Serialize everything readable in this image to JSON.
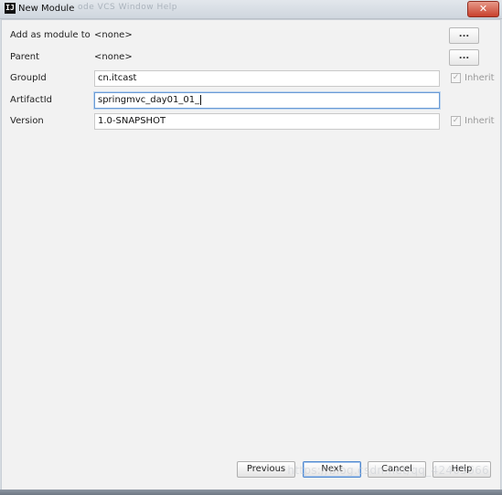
{
  "window": {
    "title": "New Module",
    "app_icon_text": "IJ",
    "ghost_menu": "ode  VCS  Window  Help"
  },
  "form": {
    "add_as_module_to": {
      "label": "Add as module to",
      "value": "<none>",
      "button": "..."
    },
    "parent": {
      "label": "Parent",
      "value": "<none>",
      "button": "..."
    },
    "group_id": {
      "label": "GroupId",
      "value": "cn.itcast",
      "inherit_label": "Inherit",
      "inherit_checked": true
    },
    "artifact_id": {
      "label": "ArtifactId",
      "value": "springmvc_day01_01_"
    },
    "version": {
      "label": "Version",
      "value": "1.0-SNAPSHOT",
      "inherit_label": "Inherit",
      "inherit_checked": true
    }
  },
  "buttons": {
    "previous": "Previous",
    "next": "Next",
    "cancel": "Cancel",
    "help": "Help"
  },
  "watermark": "https://blog.csdn.net/qq_42405666"
}
